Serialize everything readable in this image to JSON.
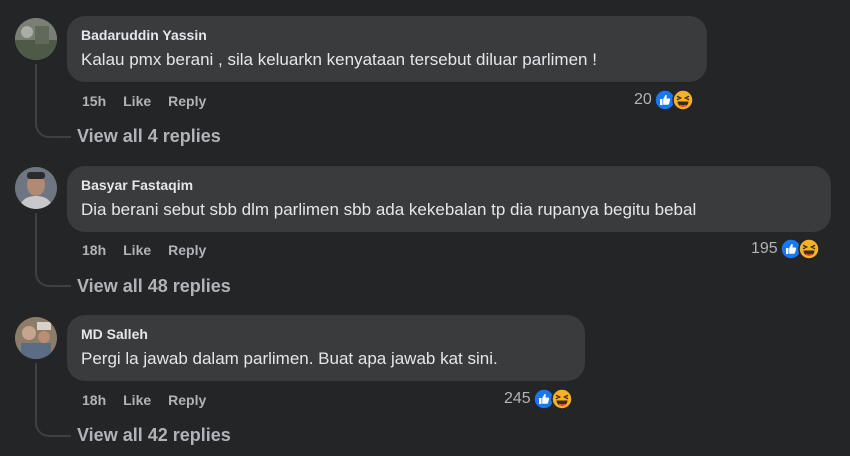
{
  "comments": [
    {
      "author": "Badaruddin Yassin",
      "text": "Kalau pmx berani , sila keluarkn kenyataan tersebut diluar parlimen !",
      "time": "15h",
      "like_label": "Like",
      "reply_label": "Reply",
      "reaction_count": "20",
      "view_replies": "View all 4 replies"
    },
    {
      "author": "Basyar Fastaqim",
      "text": "Dia berani sebut sbb dlm parlimen sbb ada kekebalan tp dia rupanya begitu bebal",
      "time": "18h",
      "like_label": "Like",
      "reply_label": "Reply",
      "reaction_count": "195",
      "view_replies": "View all 48 replies"
    },
    {
      "author": "MD Salleh",
      "text": "Pergi la jawab dalam parlimen. Buat apa jawab kat sini.",
      "time": "18h",
      "like_label": "Like",
      "reply_label": "Reply",
      "reaction_count": "245",
      "view_replies": "View all 42 replies"
    }
  ],
  "icons": {
    "reaction_primary": "like-icon",
    "reaction_secondary": "haha-icon",
    "like_color": "#1877f2",
    "haha_color": "#f7b125"
  }
}
